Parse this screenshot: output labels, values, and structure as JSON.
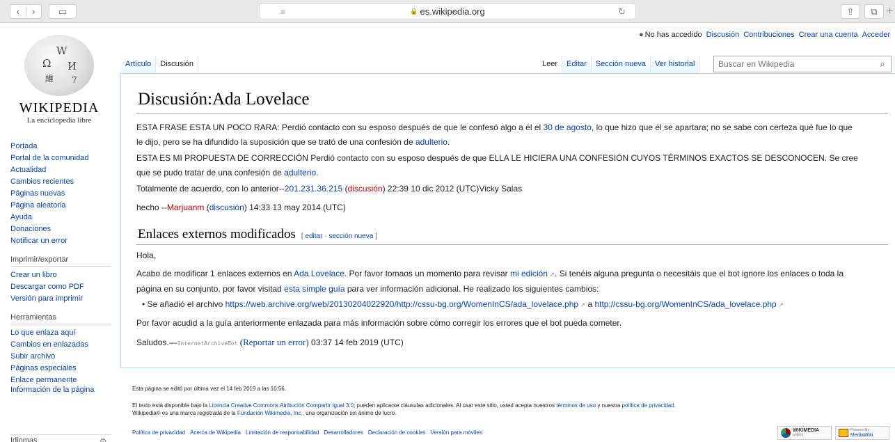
{
  "browser": {
    "url": "es.wikipedia.org",
    "back_icon": "‹",
    "forward_icon": "›",
    "sidebar_icon": "▭",
    "menu_icon": "≡",
    "lock_icon": "🔒",
    "reload_icon": "↻",
    "share_icon": "⇧",
    "tabs_icon": "⧉",
    "plus_icon": "+"
  },
  "logo": {
    "wordmark": "WIKIPEDIA",
    "tagline": "La enciclopedia libre",
    "glyphs": [
      "W",
      "Ω",
      "И",
      "維",
      "7"
    ]
  },
  "personal": {
    "status": "No has accedido",
    "links": [
      "Discusión",
      "Contribuciones",
      "Crear una cuenta",
      "Acceder"
    ]
  },
  "navigation": [
    "Portada",
    "Portal de la comunidad",
    "Actualidad",
    "Cambios recientes",
    "Páginas nuevas",
    "Página aleatoria",
    "Ayuda",
    "Donaciones",
    "Notificar un error"
  ],
  "print": {
    "heading": "Imprimir/exportar",
    "items": [
      "Crear un libro",
      "Descargar como PDF",
      "Versión para imprimir"
    ]
  },
  "tools": {
    "heading": "Herramientas",
    "items": [
      "Lo que enlaza aquí",
      "Cambios en enlazadas",
      "Subir archivo",
      "Páginas especiales",
      "Enlace permanente",
      "Información de la página"
    ]
  },
  "languages": {
    "heading": "Idiomas",
    "gear_icon": "⚙"
  },
  "tabs": {
    "left": [
      "Artículo",
      "Discusión"
    ],
    "right": [
      "Leer",
      "Editar",
      "Sección nueva",
      "Ver historial"
    ]
  },
  "search": {
    "placeholder": "Buscar en Wikipedia",
    "icon": "⌕"
  },
  "page": {
    "title": "Discusión:Ada Lovelace",
    "p1a": "ESTA FRASE ESTA UN POCO RARA: Perdió contacto con su esposo después de que le confesó algo a él el ",
    "p1_link": "30 de agosto",
    "p1b": ", lo que hizo que él se apartara; no se sabe con certeza qué fue lo que",
    "p1c": "le dijo, pero se ha difundido la suposición que se trató de una confesión de ",
    "p1_link2": "adulterio",
    "p2a": "ESTA ES MI PROPUESTA DE CORRECCIÓN Perdió contacto con su esposo después de que ELLA LE HICIERA UNA CONFESIÓN CUYOS TÉRMINOS EXACTOS SE DESCONOCEN. Se cree",
    "p2b": "que se pudo tratar de una confesión de ",
    "p2_link": "adulterio",
    "p3a": "Totalmente de acuerdo, con lo anterior--",
    "p3_ip": "201.231.36.215",
    "p3_talk": "discusión",
    "p3b": " 22:39 10 dic 2012 (UTC)Vicky Salas",
    "p4a": "hecho --",
    "p4_user": "Marjuanm",
    "p4_talk": "discusión",
    "p4b": " 14:33 13 may 2014 (UTC)",
    "section_title": "Enlaces externos modificados",
    "section_edit": "editar",
    "section_new": "sección nueva",
    "hola": "Hola,",
    "b1a": "Acabo de modificar 1 enlaces externos en ",
    "b1_link": "Ada Lovelace",
    "b1b": ". Por favor tomaos un momento para revisar ",
    "b1_link2": "mi edición",
    "b1c": ". Si tenéis alguna pregunta o necesitáis que el bot ignore los enlaces o toda la",
    "b2a": "página en su conjunto, por favor visitad ",
    "b2_link": "esta simple guía",
    "b2b": " para ver información adicional. He realizado los siguientes cambios:",
    "bullet_a": "Se añadió el archivo ",
    "bullet_link1": "https://web.archive.org/web/20130204022920/http://cssu-bg.org/WomenInCS/ada_lovelace.php",
    "bullet_mid": " a ",
    "bullet_link2": "http://cssu-bg.org/WomenInCS/ada_lovelace.php",
    "b3": "Por favor acudid a la guía anteriormente enlazada para más información sobre cómo corregir los errores que el bot pueda cometer.",
    "sign_a": "Saludos.—",
    "sign_bot": "InternetArchiveBot",
    "sign_report": "Reportar un error",
    "sign_b": " 03:37 14 feb 2019 (UTC)"
  },
  "footer": {
    "lastmod": "Esta página se editó por última vez el 14 feb 2019 a las 10:56.",
    "lic_a": "El texto está disponible bajo la ",
    "lic_link": "Licencia Creative Commons Atribución Compartir Igual 3.0",
    "lic_b": "; pueden aplicarse cláusulas adicionales. Al usar este sitio, usted acepta nuestros ",
    "lic_terms": "términos de uso",
    "lic_c": " y nuestra ",
    "lic_privacy": "política de privacidad",
    "lic_d": ".",
    "tm_a": "Wikipedia® es una marca registrada de la ",
    "tm_link": "Fundación Wikimedia, Inc.",
    "tm_b": ", una organización sin ánimo de lucro.",
    "links": [
      "Política de privacidad",
      "Acerca de Wikipedia",
      "Limitación de responsabilidad",
      "Desarrolladores",
      "Declaración de cookies",
      "Versión para móviles"
    ],
    "badge1": "WIKIMEDIA",
    "badge1_sub": "project",
    "badge2_top": "Powered By",
    "badge2": "MediaWiki"
  }
}
